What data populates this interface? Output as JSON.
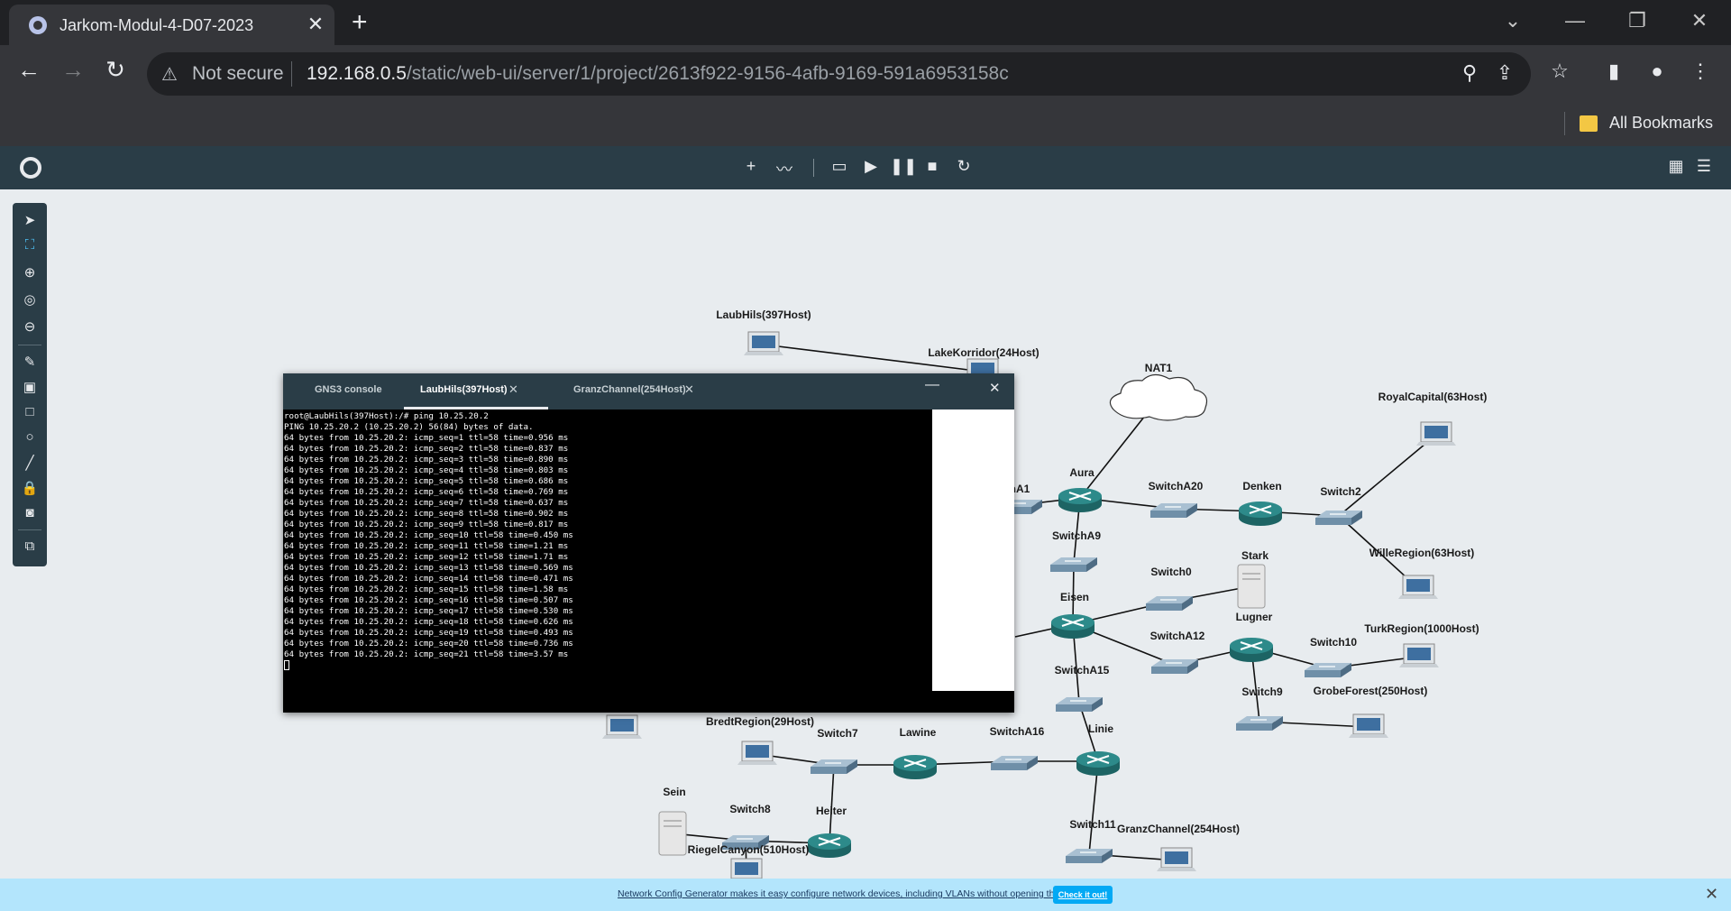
{
  "browser": {
    "tab_title": "Jarkom-Modul-4-D07-2023",
    "security_label": "Not secure",
    "url_host": "192.168.0.5",
    "url_path": "/static/web-ui/server/1/project/2613f922-9156-4afb-9169-591a6953158c",
    "bookmarks_label": "All Bookmarks"
  },
  "console": {
    "tabs": [
      {
        "label": "GNS3 console"
      },
      {
        "label": "LaubHils(397Host)"
      },
      {
        "label": "GranzChannel(254Host)"
      }
    ],
    "lines": [
      "root@LaubHils(397Host):/# ping 10.25.20.2",
      "PING 10.25.20.2 (10.25.20.2) 56(84) bytes of data.",
      "64 bytes from 10.25.20.2: icmp_seq=1 ttl=58 time=0.956 ms",
      "64 bytes from 10.25.20.2: icmp_seq=2 ttl=58 time=0.837 ms",
      "64 bytes from 10.25.20.2: icmp_seq=3 ttl=58 time=0.890 ms",
      "64 bytes from 10.25.20.2: icmp_seq=4 ttl=58 time=0.803 ms",
      "64 bytes from 10.25.20.2: icmp_seq=5 ttl=58 time=0.686 ms",
      "64 bytes from 10.25.20.2: icmp_seq=6 ttl=58 time=0.769 ms",
      "64 bytes from 10.25.20.2: icmp_seq=7 ttl=58 time=0.637 ms",
      "64 bytes from 10.25.20.2: icmp_seq=8 ttl=58 time=0.902 ms",
      "64 bytes from 10.25.20.2: icmp_seq=9 ttl=58 time=0.817 ms",
      "64 bytes from 10.25.20.2: icmp_seq=10 ttl=58 time=0.450 ms",
      "64 bytes from 10.25.20.2: icmp_seq=11 ttl=58 time=1.21 ms",
      "64 bytes from 10.25.20.2: icmp_seq=12 ttl=58 time=1.71 ms",
      "64 bytes from 10.25.20.2: icmp_seq=13 ttl=58 time=0.569 ms",
      "64 bytes from 10.25.20.2: icmp_seq=14 ttl=58 time=0.471 ms",
      "64 bytes from 10.25.20.2: icmp_seq=15 ttl=58 time=1.58 ms",
      "64 bytes from 10.25.20.2: icmp_seq=16 ttl=58 time=0.507 ms",
      "64 bytes from 10.25.20.2: icmp_seq=17 ttl=58 time=0.530 ms",
      "64 bytes from 10.25.20.2: icmp_seq=18 ttl=58 time=0.626 ms",
      "64 bytes from 10.25.20.2: icmp_seq=19 ttl=58 time=0.493 ms",
      "64 bytes from 10.25.20.2: icmp_seq=20 ttl=58 time=0.736 ms",
      "64 bytes from 10.25.20.2: icmp_seq=21 ttl=58 time=3.57 ms"
    ]
  },
  "topology": {
    "nodes": [
      {
        "id": "laubhils",
        "label": "LaubHils(397Host)",
        "type": "host"
      },
      {
        "id": "lakekorridor",
        "label": "LakeKorridor(24Host)",
        "type": "host"
      },
      {
        "id": "nat1",
        "label": "NAT1",
        "type": "cloud"
      },
      {
        "id": "royalcapital",
        "label": "RoyalCapital(63Host)",
        "type": "host"
      },
      {
        "id": "switcha1",
        "label": "hA1",
        "type": "switch"
      },
      {
        "id": "aura",
        "label": "Aura",
        "type": "router"
      },
      {
        "id": "switcha20",
        "label": "SwitchA20",
        "type": "switch"
      },
      {
        "id": "denken",
        "label": "Denken",
        "type": "router"
      },
      {
        "id": "switch2",
        "label": "Switch2",
        "type": "switch"
      },
      {
        "id": "willeregion",
        "label": "WilleRegion(63Host)",
        "type": "host"
      },
      {
        "id": "switcha9",
        "label": "SwitchA9",
        "type": "switch"
      },
      {
        "id": "stark",
        "label": "Stark",
        "type": "server"
      },
      {
        "id": "switch0",
        "label": "Switch0",
        "type": "switch"
      },
      {
        "id": "eisen",
        "label": "Eisen",
        "type": "router"
      },
      {
        "id": "lugner",
        "label": "Lugner",
        "type": "router"
      },
      {
        "id": "switcha12",
        "label": "SwitchA12",
        "type": "switch"
      },
      {
        "id": "switch10",
        "label": "Switch10",
        "type": "switch"
      },
      {
        "id": "turkregion",
        "label": "TurkRegion(1000Host)",
        "type": "host"
      },
      {
        "id": "switcha15",
        "label": "SwitchA15",
        "type": "switch"
      },
      {
        "id": "switch9",
        "label": "Switch9",
        "type": "switch"
      },
      {
        "id": "grobeforest",
        "label": "GrobeForest(250Host)",
        "type": "host"
      },
      {
        "id": "hiddenhost",
        "label": "",
        "type": "host"
      },
      {
        "id": "bredtregion",
        "label": "BredtRegion(29Host)",
        "type": "host"
      },
      {
        "id": "switch7",
        "label": "Switch7",
        "type": "switch"
      },
      {
        "id": "lawine",
        "label": "Lawine",
        "type": "router"
      },
      {
        "id": "switcha16",
        "label": "SwitchA16",
        "type": "switch"
      },
      {
        "id": "linie",
        "label": "Linie",
        "type": "router"
      },
      {
        "id": "sein",
        "label": "Sein",
        "type": "server"
      },
      {
        "id": "switch8",
        "label": "Switch8",
        "type": "switch"
      },
      {
        "id": "heiter",
        "label": "Heiter",
        "type": "router"
      },
      {
        "id": "switch11",
        "label": "Switch11",
        "type": "switch"
      },
      {
        "id": "granzchannel",
        "label": "GranzChannel(254Host)",
        "type": "host"
      },
      {
        "id": "riegelcanyon",
        "label": "RiegelCanyon(510Host)",
        "type": "host"
      }
    ],
    "links": [
      [
        "laubhils",
        "lakekorridor"
      ],
      [
        "nat1",
        "aura"
      ],
      [
        "switcha1",
        "aura"
      ],
      [
        "aura",
        "switcha20"
      ],
      [
        "switcha20",
        "denken"
      ],
      [
        "denken",
        "switch2"
      ],
      [
        "switch2",
        "royalcapital"
      ],
      [
        "switch2",
        "willeregion"
      ],
      [
        "aura",
        "switcha9"
      ],
      [
        "switcha9",
        "eisen"
      ],
      [
        "eisen",
        "switch0"
      ],
      [
        "switch0",
        "stark"
      ],
      [
        "eisen",
        "switcha12"
      ],
      [
        "switcha12",
        "lugner"
      ],
      [
        "lugner",
        "switch10"
      ],
      [
        "switch10",
        "turkregion"
      ],
      [
        "lugner",
        "switch9"
      ],
      [
        "switch9",
        "grobeforest"
      ],
      [
        "eisen",
        "switcha15"
      ],
      [
        "switcha15",
        "linie"
      ],
      [
        "eisen",
        "offscreen"
      ],
      [
        "bredtregion",
        "switch7"
      ],
      [
        "switch7",
        "lawine"
      ],
      [
        "lawine",
        "switcha16"
      ],
      [
        "switcha16",
        "linie"
      ],
      [
        "switch7",
        "heiter"
      ],
      [
        "linie",
        "switch11"
      ],
      [
        "switch11",
        "granzchannel"
      ],
      [
        "sein",
        "switch8"
      ],
      [
        "switch8",
        "heiter"
      ],
      [
        "switch8",
        "riegelcanyon"
      ]
    ]
  },
  "banner": {
    "text": "Network Config Generator makes it easy configure network devices, including VLANs without opening the CLI",
    "button": "Check it out!"
  },
  "colors": {
    "router": "#2d8a8a",
    "switch": "#6f8fa8",
    "gns_bar": "#2a3d47",
    "banner": "#b3e5fc"
  }
}
